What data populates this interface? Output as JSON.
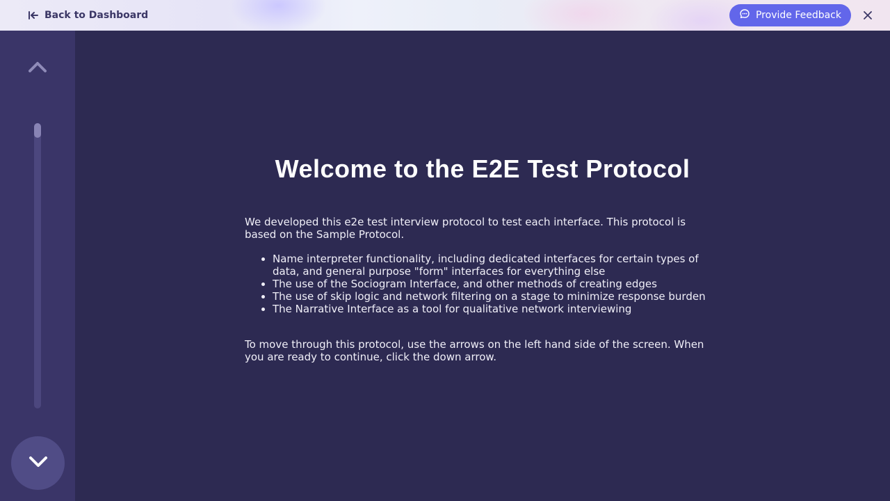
{
  "header": {
    "back_label": "Back to Dashboard",
    "feedback_label": "Provide Feedback"
  },
  "sidebar": {
    "progress_fraction": 0.05
  },
  "main": {
    "title": "Welcome to the E2E Test Protocol",
    "intro": "We developed this e2e test interview protocol to test each interface. This protocol is based on the Sample Protocol.",
    "bullets": [
      "Name interpreter functionality, including dedicated interfaces for certain types of data, and general purpose \"form\" interfaces for everything else",
      "The use of the Sociogram Interface, and other methods of creating edges",
      "The use of skip logic and network filtering on a stage to minimize response burden",
      "The Narrative Interface as a tool for qualitative network interviewing"
    ],
    "outro": "To move through this protocol, use the arrows on the left hand side of the screen. When you are ready to continue, click the down arrow."
  },
  "colors": {
    "background": "#2d2a52",
    "sidebar": "#3a3568",
    "accent": "#6266ea"
  },
  "icons": {
    "back": "arrow-left-to-bar-icon",
    "feedback": "chat-bubble-icon",
    "close": "close-icon",
    "up": "chevron-up-icon",
    "down": "chevron-down-icon"
  }
}
